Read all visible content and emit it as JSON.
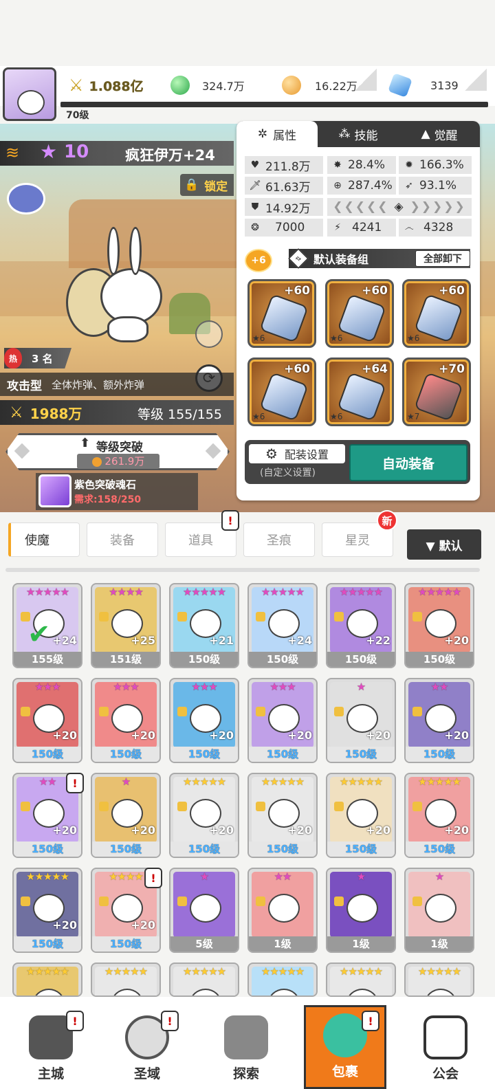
{
  "topbar": {
    "power": "1.088亿",
    "green_currency": "324.7万",
    "gold_currency": "16.22万",
    "gem_currency": "3139",
    "player_level": "70级"
  },
  "hero": {
    "stars": "10",
    "name": "疯狂伊万+24",
    "lock_label": "锁定",
    "rank_prefix": "热",
    "rank": "3 名",
    "type_label": "攻击型",
    "type_desc": "全体炸弹、额外炸弹",
    "power": "1988万",
    "level": "等级 155/155",
    "breakthrough_title": "等级突破",
    "breakthrough_cost": "261.9万",
    "stone_name": "紫色突破魂石",
    "stone_need": "需求:158/250"
  },
  "panel": {
    "tabs": [
      "属性",
      "技能",
      "觉醒"
    ],
    "stats": {
      "hp": "211.8万",
      "crit": "28.4%",
      "crit_dmg": "166.3%",
      "atk": "61.63万",
      "acc": "287.4%",
      "eva": "93.1%",
      "def": "14.92万",
      "s1": "7000",
      "s2": "4241",
      "s3": "4328"
    },
    "equip_badge": "+6",
    "equip_set_label": "默认装备组",
    "unequip_label": "全部卸下",
    "equipment": [
      {
        "level": "+60",
        "stars": "★6"
      },
      {
        "level": "+60",
        "stars": "★6"
      },
      {
        "level": "+60",
        "stars": "★6"
      },
      {
        "level": "+60",
        "stars": "★6"
      },
      {
        "level": "+64",
        "stars": "★6"
      },
      {
        "level": "+70",
        "stars": "★7"
      }
    ],
    "config_label": "配装设置",
    "config_sub": "(自定义设置)",
    "auto_label": "自动装备"
  },
  "inventory_tabs": [
    "使魔",
    "装备",
    "道具",
    "圣痕",
    "星灵"
  ],
  "new_badge": "新",
  "sort_label": "▼ 默认",
  "cards": [
    {
      "stars": "★★★★★",
      "plus": "+24",
      "level": "155级",
      "bg": "#d8c8f0",
      "gold": false
    },
    {
      "stars": "★★★★",
      "plus": "+25",
      "level": "151级",
      "bg": "#e8c870",
      "gold": false
    },
    {
      "stars": "★★★★★",
      "plus": "+21",
      "level": "150级",
      "bg": "#9ad8f0",
      "gold": false
    },
    {
      "stars": "★★★★★",
      "plus": "+24",
      "level": "150级",
      "bg": "#b8d8f8",
      "gold": false
    },
    {
      "stars": "★★★★★",
      "plus": "+22",
      "level": "150级",
      "bg": "#b08ae0",
      "gold": false
    },
    {
      "stars": "★★★★★",
      "plus": "+20",
      "level": "150级",
      "bg": "#e89080",
      "gold": false
    },
    {
      "stars": "★★★",
      "plus": "+20",
      "level": "150级",
      "bg": "#e07070",
      "gold": false
    },
    {
      "stars": "★★★",
      "plus": "+20",
      "level": "150级",
      "bg": "#f08a8a",
      "gold": false
    },
    {
      "stars": "★★★",
      "plus": "+20",
      "level": "150级",
      "bg": "#6ab8e8",
      "gold": false
    },
    {
      "stars": "★★★",
      "plus": "+20",
      "level": "150级",
      "bg": "#c0a0e8",
      "gold": false
    },
    {
      "stars": "★",
      "plus": "+20",
      "level": "150级",
      "bg": "#e0e0e0",
      "gold": false
    },
    {
      "stars": "★★",
      "plus": "+20",
      "level": "150级",
      "bg": "#9080c8",
      "gold": false
    },
    {
      "stars": "★★",
      "plus": "+20",
      "level": "150级",
      "bg": "#c8a8f0",
      "gold": false
    },
    {
      "stars": "★",
      "plus": "+20",
      "level": "150级",
      "bg": "#e8c070",
      "gold": false
    },
    {
      "stars": "★★★★★",
      "plus": "+20",
      "level": "150级",
      "bg": "#e8e8e8",
      "gold": true
    },
    {
      "stars": "★★★★★",
      "plus": "+20",
      "level": "150级",
      "bg": "#e8e8e8",
      "gold": true
    },
    {
      "stars": "★★★★★",
      "plus": "+20",
      "level": "150级",
      "bg": "#f0e0c0",
      "gold": true
    },
    {
      "stars": "★★★★★",
      "plus": "+20",
      "level": "150级",
      "bg": "#f0a0a0",
      "gold": true
    },
    {
      "stars": "★★★★★",
      "plus": "+20",
      "level": "150级",
      "bg": "#7070a0",
      "gold": true
    },
    {
      "stars": "★★★★",
      "plus": "+20",
      "level": "150级",
      "bg": "#f0b0b0",
      "gold": true
    },
    {
      "stars": "★",
      "plus": "",
      "level": "5级",
      "bg": "#9a70d8",
      "gold": false
    },
    {
      "stars": "★★",
      "plus": "",
      "level": "1级",
      "bg": "#f0a0a0",
      "gold": false
    },
    {
      "stars": "★",
      "plus": "",
      "level": "1级",
      "bg": "#7a50c0",
      "gold": false
    },
    {
      "stars": "★",
      "plus": "",
      "level": "1级",
      "bg": "#f0c0c0",
      "gold": false
    },
    {
      "stars": "★★★★★",
      "plus": "",
      "level": "",
      "bg": "#e8c870",
      "gold": true
    },
    {
      "stars": "★★★★★",
      "plus": "",
      "level": "",
      "bg": "#e8e8e8",
      "gold": true
    },
    {
      "stars": "★★★★★",
      "plus": "",
      "level": "",
      "bg": "#e8e8e8",
      "gold": true
    },
    {
      "stars": "★★★★★",
      "plus": "",
      "level": "",
      "bg": "#b8e0f8",
      "gold": true
    },
    {
      "stars": "★★★★★",
      "plus": "",
      "level": "",
      "bg": "#e8e8e8",
      "gold": true
    },
    {
      "stars": "★★★★★",
      "plus": "",
      "level": "",
      "bg": "#e8e8e8",
      "gold": true
    }
  ],
  "nav": [
    "主城",
    "圣域",
    "探索",
    "包裹",
    "公会"
  ],
  "alert": "!"
}
